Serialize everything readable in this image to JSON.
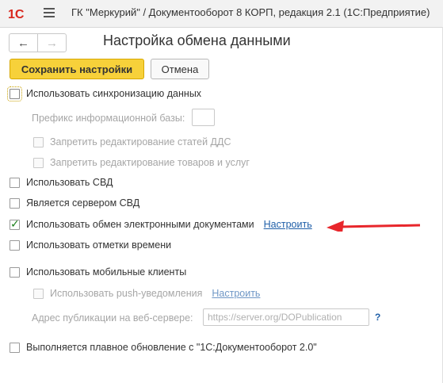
{
  "titlebar": {
    "logo_text": "1С",
    "title": "ГК \"Меркурий\" / Документооборот 8 КОРП, редакция 2.1  (1С:Предприятие)"
  },
  "nav": {
    "back_icon": "arrow-left-icon",
    "forward_icon": "arrow-right-icon"
  },
  "form": {
    "title": "Настройка обмена данными"
  },
  "toolbar": {
    "save_label": "Сохранить настройки",
    "cancel_label": "Отмена"
  },
  "settings": {
    "sync": {
      "label": "Использовать синхронизацию данных",
      "checked": false
    },
    "prefix": {
      "label": "Префикс информационной базы:",
      "value": ""
    },
    "forbid_dds": {
      "label": "Запретить редактирование статей ДДС",
      "checked": false
    },
    "forbid_goods": {
      "label": "Запретить редактирование товаров и услуг",
      "checked": false
    },
    "svd": {
      "label": "Использовать СВД",
      "checked": false
    },
    "svd_server": {
      "label": "Является сервером СВД",
      "checked": false
    },
    "edo": {
      "label": "Использовать обмен электронными документами",
      "checked": true,
      "link": "Настроить"
    },
    "timestamps": {
      "label": "Использовать отметки времени",
      "checked": false
    },
    "mobile": {
      "label": "Использовать мобильные клиенты",
      "checked": false
    },
    "push": {
      "label": "Использовать push-уведомления",
      "checked": false,
      "link": "Настроить"
    },
    "publication": {
      "label": "Адрес публикации на веб-сервере:",
      "placeholder": "https://server.org/DOPublication",
      "help": "?"
    },
    "smooth_update": {
      "label": "Выполняется плавное обновление с \"1С:Документооборот 2.0\"",
      "checked": false
    }
  },
  "colors": {
    "save_button": "#f7d13a",
    "link": "#1f5fa8",
    "arrow": "#e8262b",
    "checkmark": "#1a7f1a"
  }
}
